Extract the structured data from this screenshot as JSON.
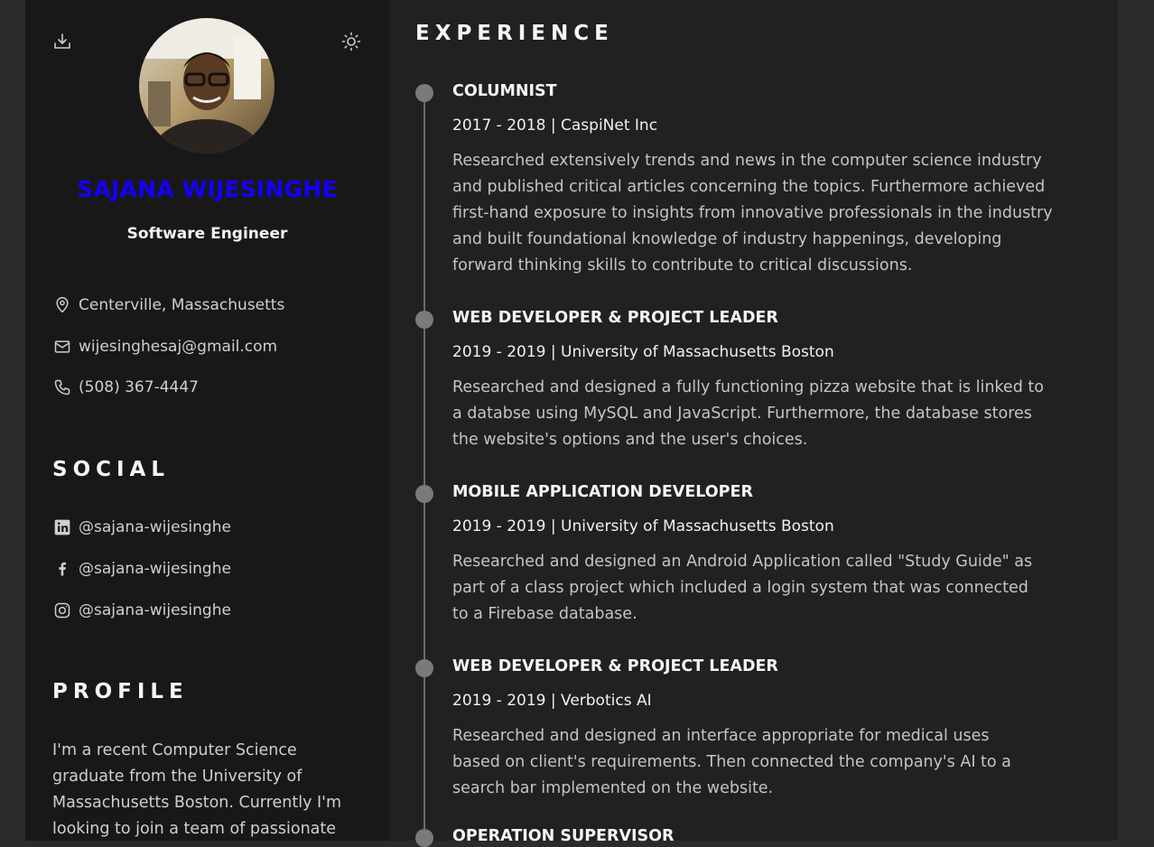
{
  "header": {
    "name": "SAJANA WIJESINGHE",
    "title": "Software Engineer",
    "download_icon": "download-icon",
    "theme_icon": "sun-icon"
  },
  "contact": {
    "location": "Centerville, Massachusetts",
    "email": "wijesinghesaj@gmail.com",
    "phone": "(508) 367-4447"
  },
  "social": {
    "heading": "SOCIAL",
    "linkedin": "@sajana-wijesinghe",
    "facebook": "@sajana-wijesinghe",
    "instagram": "@sajana-wijesinghe"
  },
  "profile": {
    "heading": "PROFILE",
    "lines": [
      "I'm a recent Computer Science",
      "graduate from the University of",
      "Massachusetts Boston. Currently I'm",
      "looking to join a team of passionate"
    ]
  },
  "experience": {
    "heading": "EXPERIENCE",
    "jobs": [
      {
        "title": "COLUMNIST",
        "meta": "2017 - 2018 | CaspiNet Inc",
        "lines": [
          "Researched extensively trends and news in the computer science industry",
          "and published critical articles concerning the topics. Furthermore achieved",
          "first-hand exposure to insights from innovative professionals in the industry",
          "and built foundational knowledge of industry happenings, developing",
          "forward thinking skills to contribute to critical discussions."
        ]
      },
      {
        "title": "WEB DEVELOPER & PROJECT LEADER",
        "meta": "2019 - 2019 | University of Massachusetts Boston",
        "lines": [
          "Researched and designed a fully functioning pizza website that is linked to",
          "a databse using MySQL and JavaScript. Furthermore, the database stores",
          "the website's options and the user's choices."
        ]
      },
      {
        "title": "MOBILE APPLICATION DEVELOPER",
        "meta": "2019 - 2019 | University of Massachusetts Boston",
        "lines": [
          "Researched and designed an Android Application called \"Study Guide\" as",
          "part of a class project which included a login system that was connected",
          "to a Firebase database."
        ]
      },
      {
        "title": "WEB DEVELOPER & PROJECT LEADER",
        "meta": "2019 - 2019 | Verbotics AI",
        "lines": [
          "Researched and designed an interface appropriate for medical uses",
          "based on client's requirements. Then connected the company's AI to a",
          "search bar implemented on the website."
        ]
      },
      {
        "title": "OPERATION SUPERVISOR"
      }
    ]
  }
}
